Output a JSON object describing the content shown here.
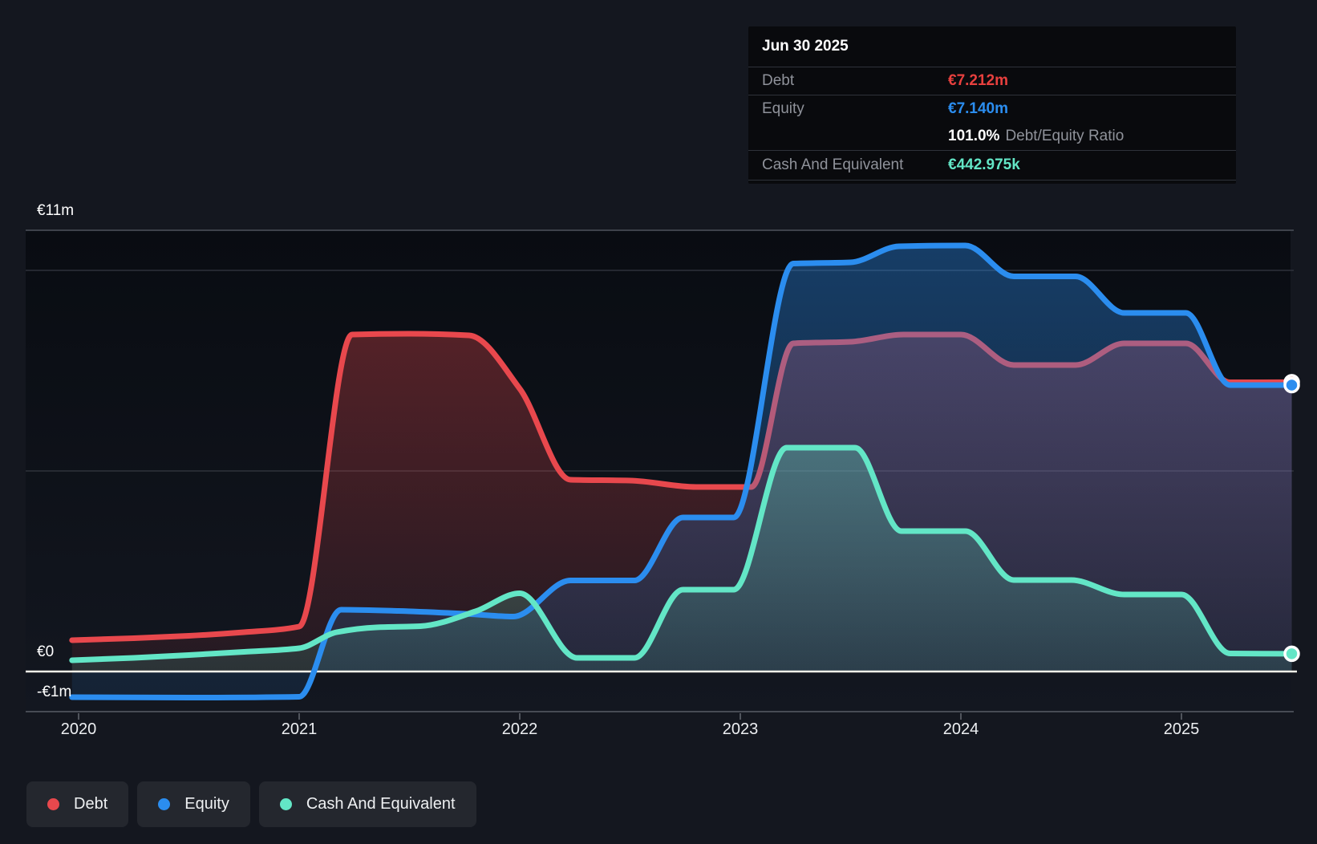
{
  "tooltip": {
    "date": "Jun 30 2025",
    "debt": {
      "label": "Debt",
      "value": "€7.212m"
    },
    "equity": {
      "label": "Equity",
      "value": "€7.140m"
    },
    "ratio": {
      "value": "101.0%",
      "label": "Debt/Equity Ratio"
    },
    "cash": {
      "label": "Cash And Equivalent",
      "value": "€442.975k"
    }
  },
  "colors": {
    "debt": "#e8484d",
    "equity": "#2b8def",
    "cash": "#63e6c6",
    "zero_line": "#f5f2e9",
    "grid_major": "#3e424b",
    "grid_minor": "#2e323b",
    "axis_line": "#474b54"
  },
  "chart_data": {
    "type": "area",
    "currency": "EUR",
    "unit": "millions",
    "x_axis": {
      "ticks": [
        "2020",
        "2021",
        "2022",
        "2023",
        "2024",
        "2025"
      ],
      "range": [
        2019.97,
        2025.5
      ]
    },
    "y_axis": {
      "labels": {
        "max": "€11m",
        "zero": "€0",
        "min": "-€1m"
      },
      "range_m": [
        -1,
        11
      ],
      "gridlines_m": [
        11,
        10,
        5,
        0,
        -1
      ]
    },
    "series": [
      {
        "id": "debt",
        "name": "Debt",
        "color": "#e8484d",
        "points": [
          [
            2019.97,
            0.78
          ],
          [
            2020.25,
            0.83
          ],
          [
            2020.5,
            0.89
          ],
          [
            2020.75,
            0.98
          ],
          [
            2021.0,
            1.12
          ],
          [
            2021.24,
            8.4
          ],
          [
            2021.5,
            8.42
          ],
          [
            2021.77,
            8.38
          ],
          [
            2022.0,
            7.05
          ],
          [
            2022.23,
            4.78
          ],
          [
            2022.5,
            4.76
          ],
          [
            2022.8,
            4.6
          ],
          [
            2023.05,
            4.6
          ],
          [
            2023.24,
            8.18
          ],
          [
            2023.5,
            8.22
          ],
          [
            2023.74,
            8.4
          ],
          [
            2024.0,
            8.4
          ],
          [
            2024.24,
            7.64
          ],
          [
            2024.52,
            7.64
          ],
          [
            2024.74,
            8.18
          ],
          [
            2025.02,
            8.18
          ],
          [
            2025.22,
            7.21
          ],
          [
            2025.5,
            7.212
          ]
        ],
        "last_value_label": "€7.212m"
      },
      {
        "id": "equity",
        "name": "Equity",
        "color": "#2b8def",
        "points": [
          [
            2019.97,
            -0.64
          ],
          [
            2020.5,
            -0.65
          ],
          [
            2021.0,
            -0.63
          ],
          [
            2021.19,
            1.54
          ],
          [
            2021.45,
            1.51
          ],
          [
            2021.75,
            1.44
          ],
          [
            2021.97,
            1.37
          ],
          [
            2022.23,
            2.27
          ],
          [
            2022.52,
            2.27
          ],
          [
            2022.74,
            3.84
          ],
          [
            2022.97,
            3.84
          ],
          [
            2023.24,
            10.17
          ],
          [
            2023.5,
            10.2
          ],
          [
            2023.72,
            10.6
          ],
          [
            2024.02,
            10.62
          ],
          [
            2024.24,
            9.85
          ],
          [
            2024.52,
            9.85
          ],
          [
            2024.74,
            8.94
          ],
          [
            2025.02,
            8.94
          ],
          [
            2025.22,
            7.14
          ],
          [
            2025.5,
            7.14
          ]
        ],
        "last_value_label": "€7.140m"
      },
      {
        "id": "cash",
        "name": "Cash And Equivalent",
        "color": "#63e6c6",
        "points": [
          [
            2019.97,
            0.28
          ],
          [
            2020.25,
            0.34
          ],
          [
            2020.5,
            0.41
          ],
          [
            2020.75,
            0.49
          ],
          [
            2021.0,
            0.58
          ],
          [
            2021.17,
            0.98
          ],
          [
            2021.35,
            1.1
          ],
          [
            2021.55,
            1.13
          ],
          [
            2021.8,
            1.5
          ],
          [
            2022.0,
            1.95
          ],
          [
            2022.26,
            0.34
          ],
          [
            2022.52,
            0.34
          ],
          [
            2022.74,
            2.04
          ],
          [
            2022.97,
            2.04
          ],
          [
            2023.21,
            5.58
          ],
          [
            2023.52,
            5.58
          ],
          [
            2023.73,
            3.5
          ],
          [
            2024.02,
            3.5
          ],
          [
            2024.24,
            2.28
          ],
          [
            2024.5,
            2.28
          ],
          [
            2024.74,
            1.92
          ],
          [
            2025.0,
            1.92
          ],
          [
            2025.22,
            0.45
          ],
          [
            2025.5,
            0.443
          ]
        ],
        "last_value_label": "€442.975k"
      }
    ]
  }
}
